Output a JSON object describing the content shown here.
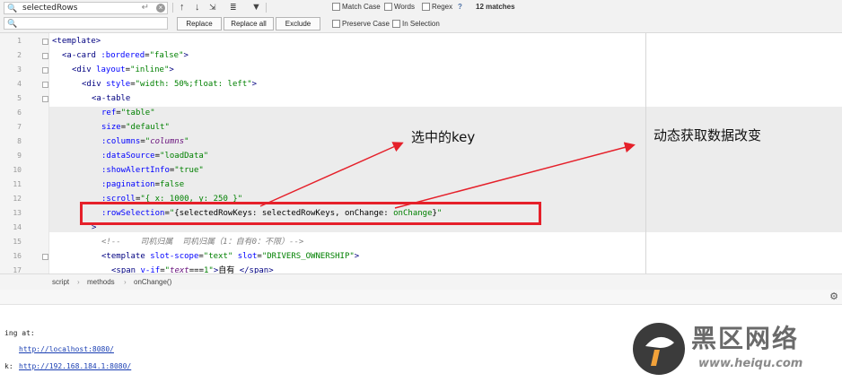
{
  "find_bar": {
    "search_value": "selectedRows",
    "replace_value": "",
    "replace_button": "Replace",
    "replace_all_button": "Replace all",
    "exclude_button": "Exclude",
    "match_case_label": "Match Case",
    "words_label": "Words",
    "regex_label": "Regex",
    "help_label": "?",
    "match_count": "12 matches",
    "preserve_case_label": "Preserve Case",
    "in_selection_label": "In Selection"
  },
  "editor": {
    "lines": [
      {
        "n": "1"
      },
      {
        "n": "2"
      },
      {
        "n": "3"
      },
      {
        "n": "4"
      },
      {
        "n": "5"
      },
      {
        "n": "6"
      },
      {
        "n": "7"
      },
      {
        "n": "8"
      },
      {
        "n": "9"
      },
      {
        "n": "10"
      },
      {
        "n": "11"
      },
      {
        "n": "12"
      },
      {
        "n": "13"
      },
      {
        "n": "14"
      },
      {
        "n": "15"
      },
      {
        "n": "16"
      },
      {
        "n": "17"
      }
    ]
  },
  "breadcrumb": [
    "script",
    "methods",
    "onChange()"
  ],
  "terminal": {
    "line1": "ing at:",
    "local_prefix": "  ",
    "local_url": "http://localhost:8080/",
    "network_prefix": "k: ",
    "network_url": "http://192.168.184.1:8080/"
  },
  "annotations": {
    "selected_key": "选中的key",
    "dynamic_change": "动态获取数据改变"
  },
  "watermark": {
    "title": "黑区网络",
    "url": "www.heiqu.com"
  },
  "colors": {
    "annotation_red": "#e5202a",
    "tag": "#000080",
    "attribute": "#0000ff",
    "string": "#008000"
  }
}
